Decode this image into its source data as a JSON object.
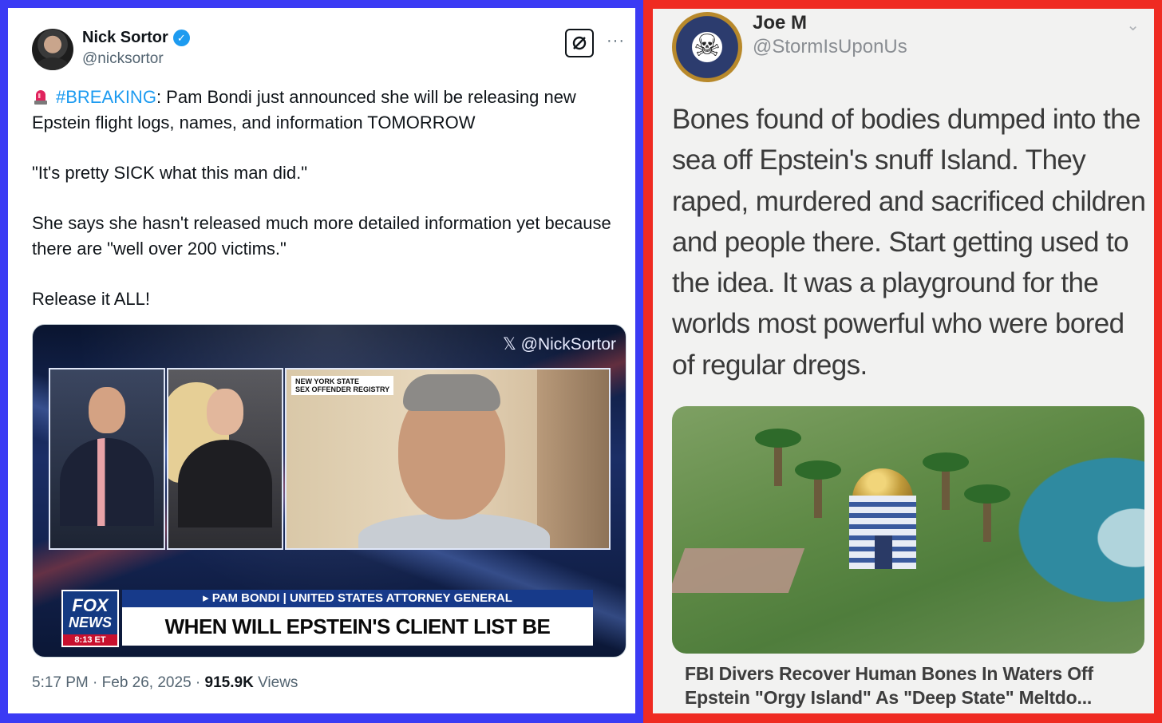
{
  "left_tweet": {
    "author": {
      "name": "Nick Sortor",
      "handle": "@nicksortor",
      "verified_icon": "verified-badge-icon"
    },
    "paragraphs": [
      {
        "prefix_icon": "rotating-light-icon",
        "hashtag": "#BREAKING",
        "text": ": Pam Bondi just announced she will be releasing new Epstein flight logs, names, and information TOMORROW"
      },
      {
        "text": "\"It's pretty SICK what this man did.\""
      },
      {
        "text": "She says she hasn't released much more detailed information yet because there are \"well over 200 victims.\""
      },
      {
        "text": "Release it ALL!"
      }
    ],
    "media": {
      "watermark": "𝕏 @NickSortor",
      "registry_tag_line1": "NEW YORK STATE",
      "registry_tag_line2": "SEX OFFENDER REGISTRY",
      "network_logo_line1": "FOX",
      "network_logo_line2": "NEWS",
      "network_time": "8:13 ET",
      "chyron_top": "▸ PAM BONDI | UNITED STATES ATTORNEY GENERAL",
      "chyron_main": "WHEN WILL EPSTEIN'S CLIENT LIST BE RELEASED?"
    },
    "meta": {
      "time": "5:17 PM",
      "date": "Feb 26, 2025",
      "views_count": "915.9K",
      "views_label": "Views",
      "separator": "·"
    },
    "colors": {
      "hashtag": "#1d9bf0",
      "border": "#3b3bf4"
    }
  },
  "right_tweet": {
    "author": {
      "name": "Joe M",
      "handle": "@StormIsUponUs"
    },
    "text": "Bones found of bodies dumped into the sea off Epstein's snuff Island. They raped, murdered and sacrificed children and people there. Start getting used to the idea. It was a playground for the worlds most powerful who were bored of regular dregs.",
    "caption": "FBI Divers Recover Human Bones In Waters Off Epstein \"Orgy Island\" As \"Deep State\" Meltdo...",
    "colors": {
      "border": "#ef2b22"
    }
  }
}
